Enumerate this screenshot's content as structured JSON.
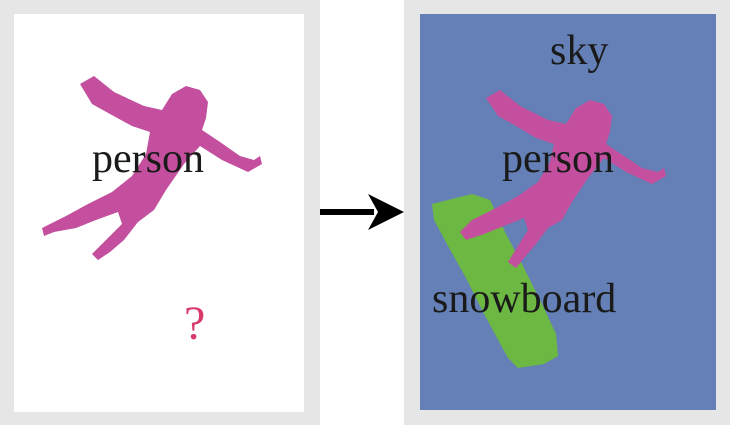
{
  "input_panel": {
    "labels": {
      "person": "person",
      "unknown": "?"
    }
  },
  "output_panel": {
    "labels": {
      "sky": "sky",
      "person": "person",
      "snowboard": "snowboard"
    }
  },
  "colors": {
    "frame": "#e6e6e6",
    "person": "#c34f9e",
    "sky": "#6480b6",
    "snowboard": "#6db842",
    "question_mark": "#d83a6b",
    "arrow": "#000000"
  }
}
